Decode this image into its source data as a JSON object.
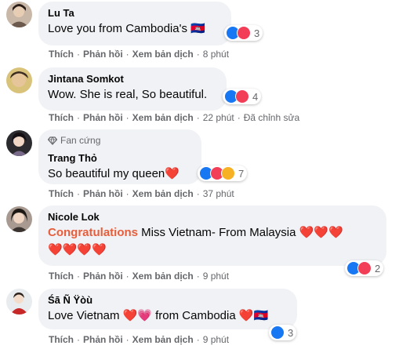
{
  "comments": [
    {
      "name": "Lu Ta",
      "text": "Love you from Cambodia's 🇰🇭",
      "reactions": "3",
      "like_label": "Thích",
      "reply_label": "Phản hồi",
      "translate_label": "Xem bản dịch",
      "time": "8 phút"
    },
    {
      "name": "Jintana Somkot",
      "text": "Wow. She is real, So beautiful.",
      "reactions": "4",
      "like_label": "Thích",
      "reply_label": "Phản hồi",
      "translate_label": "Xem bản dịch",
      "time": "22 phút",
      "edited": "Đã chỉnh sửa"
    },
    {
      "badge": "Fan cứng",
      "name": "Trang Thỏ",
      "text": "So beautiful my queen❤️",
      "reactions": "7",
      "like_label": "Thích",
      "reply_label": "Phản hồi",
      "translate_label": "Xem bản dịch",
      "time": "37 phút"
    },
    {
      "name": "Nicole Lok",
      "highlight": "Congratulations",
      "text": " Miss Vietnam- From Malaysia ❤️❤️❤️",
      "text2": "❤️❤️❤️❤️",
      "reactions": "2",
      "like_label": "Thích",
      "reply_label": "Phản hồi",
      "translate_label": "Xem bản dịch",
      "time": "9 phút"
    },
    {
      "name": "Śā Ñ Ÿòù",
      "text": "Love Vietnam ❤️💗 from Cambodia ❤️🇰🇭",
      "reactions": "3",
      "like_label": "Thích",
      "reply_label": "Phản hồi",
      "translate_label": "Xem bản dịch",
      "time": "9 phút"
    }
  ],
  "colors": {
    "bubble": "#f0f2f5",
    "meta": "#65676b",
    "like": "#1877f2",
    "love": "#f33e58",
    "haha": "#f7b125"
  },
  "icons": [
    "diamond-icon",
    "like-reaction-icon",
    "love-reaction-icon",
    "haha-reaction-icon"
  ]
}
